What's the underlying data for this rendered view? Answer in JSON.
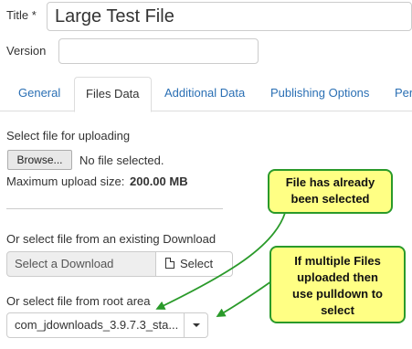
{
  "form": {
    "title_label": "Title *",
    "title_value": "Large Test File",
    "version_label": "Version",
    "version_value": ""
  },
  "tabs": [
    {
      "label": "General",
      "active": false
    },
    {
      "label": "Files Data",
      "active": true
    },
    {
      "label": "Additional Data",
      "active": false
    },
    {
      "label": "Publishing Options",
      "active": false
    },
    {
      "label": "Per",
      "active": false
    }
  ],
  "upload": {
    "heading": "Select file for uploading",
    "browse_label": "Browse...",
    "status": "No file selected.",
    "max_label": "Maximum upload size:",
    "max_value": "200.00 MB"
  },
  "existing": {
    "heading": "Or select file from an existing Download",
    "field_placeholder": "Select a Download",
    "select_label": "Select"
  },
  "root": {
    "heading": "Or select file from root area",
    "selected_value": "com_jdownloads_3.9.7.3_sta..."
  },
  "annotations": {
    "callout1_line1": "File has already",
    "callout1_line2": "been selected",
    "callout2_line1": "If multiple Files",
    "callout2_line2": "uploaded then",
    "callout2_line3": "use pulldown to",
    "callout2_line4": "select"
  },
  "colors": {
    "link": "#2a6fb4",
    "callout_bg": "#ffff84",
    "callout_border": "#2a9a2a",
    "arrow": "#2a9a2a"
  }
}
